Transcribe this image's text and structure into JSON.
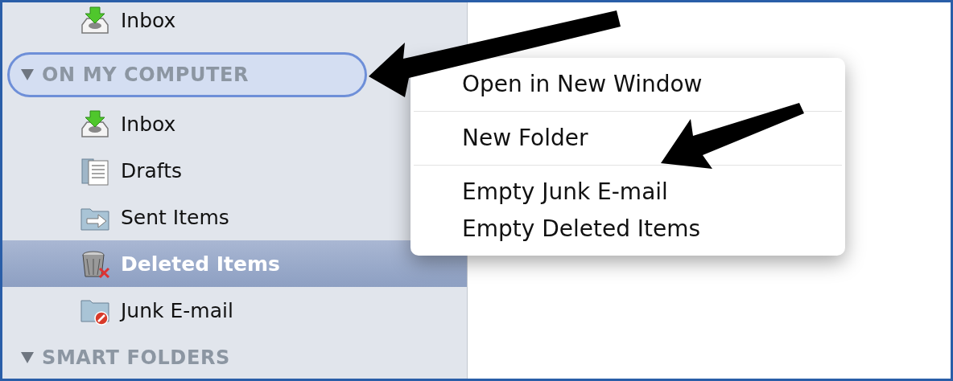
{
  "sidebar": {
    "top_items": [
      {
        "kind": "inbox",
        "label": "Inbox",
        "selected": false
      }
    ],
    "sections": [
      {
        "title": "ON MY COMPUTER",
        "expanded": true,
        "focused": true,
        "children": [
          {
            "kind": "inbox",
            "label": "Inbox",
            "selected": false
          },
          {
            "kind": "drafts",
            "label": "Drafts",
            "selected": false
          },
          {
            "kind": "sent",
            "label": "Sent Items",
            "selected": false
          },
          {
            "kind": "trash",
            "label": "Deleted Items",
            "selected": true
          },
          {
            "kind": "junk",
            "label": "Junk E-mail",
            "selected": false
          }
        ]
      },
      {
        "title": "SMART FOLDERS",
        "expanded": true,
        "focused": false
      }
    ]
  },
  "context_menu": {
    "groups": [
      [
        "Open in New Window"
      ],
      [
        "New Folder"
      ],
      [
        "Empty Junk E-mail",
        "Empty Deleted Items"
      ]
    ]
  }
}
